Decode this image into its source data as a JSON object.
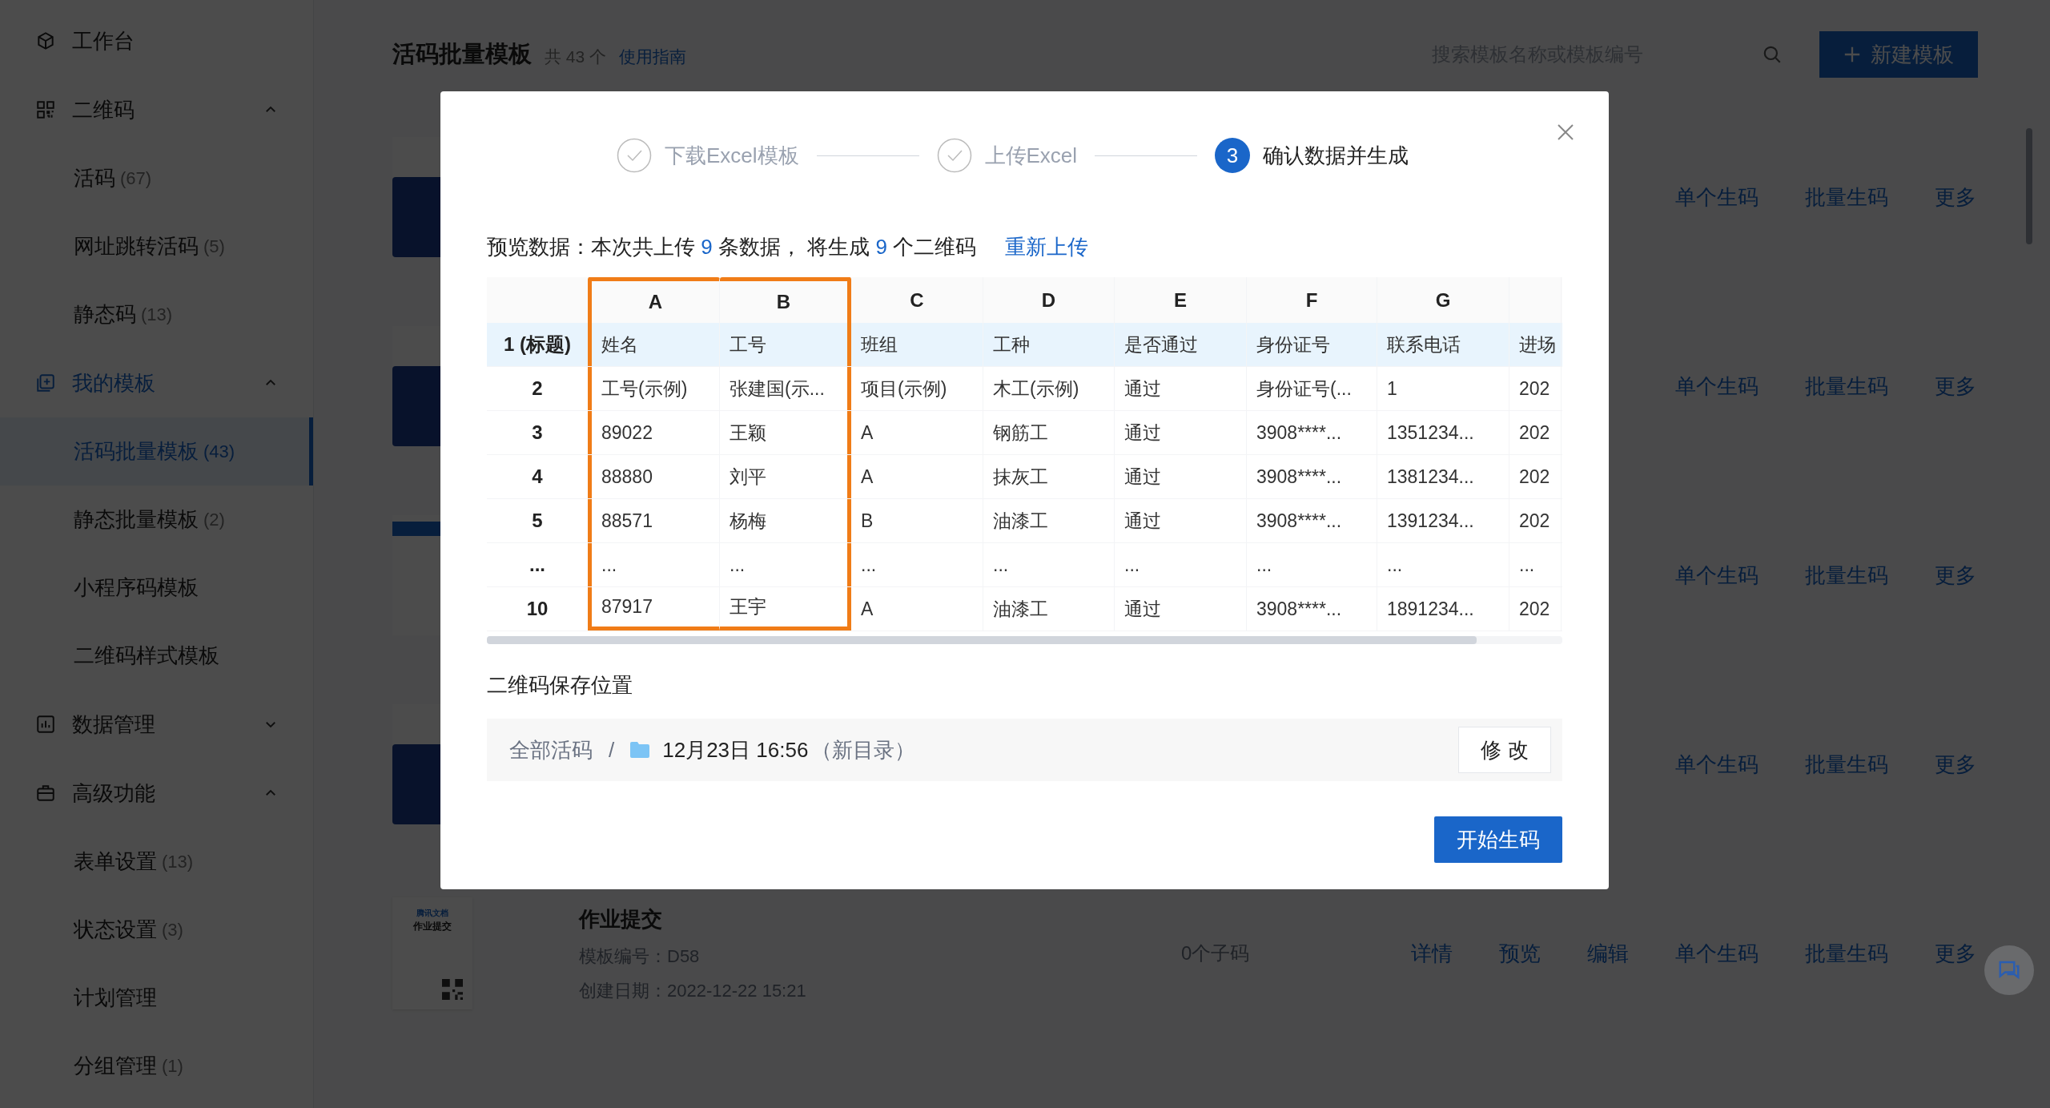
{
  "sidebar": {
    "items": [
      {
        "kind": "group",
        "label": "工作台",
        "selected": false
      },
      {
        "kind": "group",
        "label": "二维码",
        "expanded": true,
        "selected": false,
        "children": [
          {
            "label": "活码",
            "count": "(67)",
            "selected": false
          },
          {
            "label": "网址跳转活码",
            "count": "(5)",
            "selected": false
          },
          {
            "label": "静态码",
            "count": "(13)",
            "selected": false
          }
        ]
      },
      {
        "kind": "group",
        "label": "我的模板",
        "expanded": true,
        "selected": true,
        "children": [
          {
            "label": "活码批量模板",
            "count": "(43)",
            "selected": true
          },
          {
            "label": "静态批量模板",
            "count": "(2)",
            "selected": false
          },
          {
            "label": "小程序码模板",
            "selected": false
          },
          {
            "label": "二维码样式模板",
            "selected": false
          }
        ]
      },
      {
        "kind": "group",
        "label": "数据管理",
        "expanded": false,
        "selected": false
      },
      {
        "kind": "group",
        "label": "高级功能",
        "expanded": true,
        "selected": false,
        "children": [
          {
            "label": "表单设置",
            "count": "(13)",
            "selected": false
          },
          {
            "label": "状态设置",
            "count": "(3)",
            "selected": false
          },
          {
            "label": "计划管理",
            "selected": false
          },
          {
            "label": "分组管理",
            "count": "(1)",
            "selected": false
          }
        ]
      }
    ]
  },
  "header": {
    "title": "活码批量模板",
    "total": "共 43 个",
    "guide_link": "使用指南",
    "search": {
      "placeholder": "搜索模板名称或模板编号"
    },
    "new_button": "新建模板"
  },
  "templates": [
    {
      "kind": "blue",
      "actions": [
        "单个生码",
        "批量生码",
        "更多"
      ]
    },
    {
      "kind": "blue",
      "actions": [
        "单个生码",
        "批量生码",
        "更多"
      ]
    },
    {
      "kind": "light",
      "actions": [
        "单个生码",
        "批量生码",
        "更多"
      ]
    },
    {
      "kind": "blue",
      "actions": [
        "单个生码",
        "批量生码",
        "更多"
      ]
    },
    {
      "kind": "doc",
      "thumb_texts": [
        "腾讯文档",
        "作业提交"
      ],
      "title": "作业提交",
      "code": "模板编号：D58",
      "date": "创建日期：2022-12-22 15:21",
      "subcodes": "0个子码",
      "actions": [
        "详情",
        "预览",
        "编辑",
        "单个生码",
        "批量生码",
        "更多"
      ]
    }
  ],
  "dialog": {
    "steps": [
      {
        "label": "下载Excel模板",
        "done": true,
        "selected": false
      },
      {
        "label": "上传Excel",
        "done": true,
        "selected": false
      },
      {
        "label": "确认数据并生成",
        "done": false,
        "selected": true,
        "number": "3"
      }
    ],
    "summary_parts": [
      "预览数据：本次共上传 ",
      "9",
      " 条数据， 将生成 ",
      "9",
      " 个二维码"
    ],
    "reupload_link": "重新上传",
    "table": {
      "columns": [
        {
          "label": "A",
          "highlighted": true
        },
        {
          "label": "B",
          "highlighted": true
        },
        {
          "label": "C",
          "highlighted": false
        },
        {
          "label": "D",
          "highlighted": false
        },
        {
          "label": "E",
          "highlighted": false
        },
        {
          "label": "F",
          "highlighted": false
        },
        {
          "label": "G",
          "highlighted": false
        },
        {
          "highlighted": false
        }
      ],
      "rows": [
        {
          "kind": "title",
          "header": "1 (标题)",
          "cells": [
            "姓名",
            "工号",
            "班组",
            "工种",
            "是否通过",
            "身份证号",
            "联系电话",
            "进场"
          ]
        },
        {
          "kind": "data",
          "header": "2",
          "cells": [
            "工号(示例)",
            "张建国(示...",
            "项目(示例)",
            "木工(示例)",
            "通过",
            "身份证号(...",
            "1",
            "202"
          ]
        },
        {
          "kind": "data",
          "header": "3",
          "cells": [
            "89022",
            "王颖",
            "A",
            "钢筋工",
            "通过",
            "3908****...",
            "1351234...",
            "202"
          ]
        },
        {
          "kind": "data",
          "header": "4",
          "cells": [
            "88880",
            "刘平",
            "A",
            "抹灰工",
            "通过",
            "3908****...",
            "1381234...",
            "202"
          ]
        },
        {
          "kind": "data",
          "header": "5",
          "cells": [
            "88571",
            "杨梅",
            "B",
            "油漆工",
            "通过",
            "3908****...",
            "1391234...",
            "202"
          ]
        },
        {
          "kind": "data",
          "header": "...",
          "cells": [
            "...",
            "...",
            "...",
            "...",
            "...",
            "...",
            "...",
            "..."
          ]
        },
        {
          "kind": "data",
          "header": "10",
          "cells": [
            "87917",
            "王宇",
            "A",
            "油漆工",
            "通过",
            "3908****...",
            "1891234...",
            "202"
          ]
        }
      ]
    },
    "save_location": {
      "label": "二维码保存位置",
      "root": "全部活码",
      "separator": "/",
      "folder": "12月23日 16:56",
      "folder_note": "（新目录）",
      "edit_button": "修 改"
    },
    "start_button": "开始生码"
  }
}
